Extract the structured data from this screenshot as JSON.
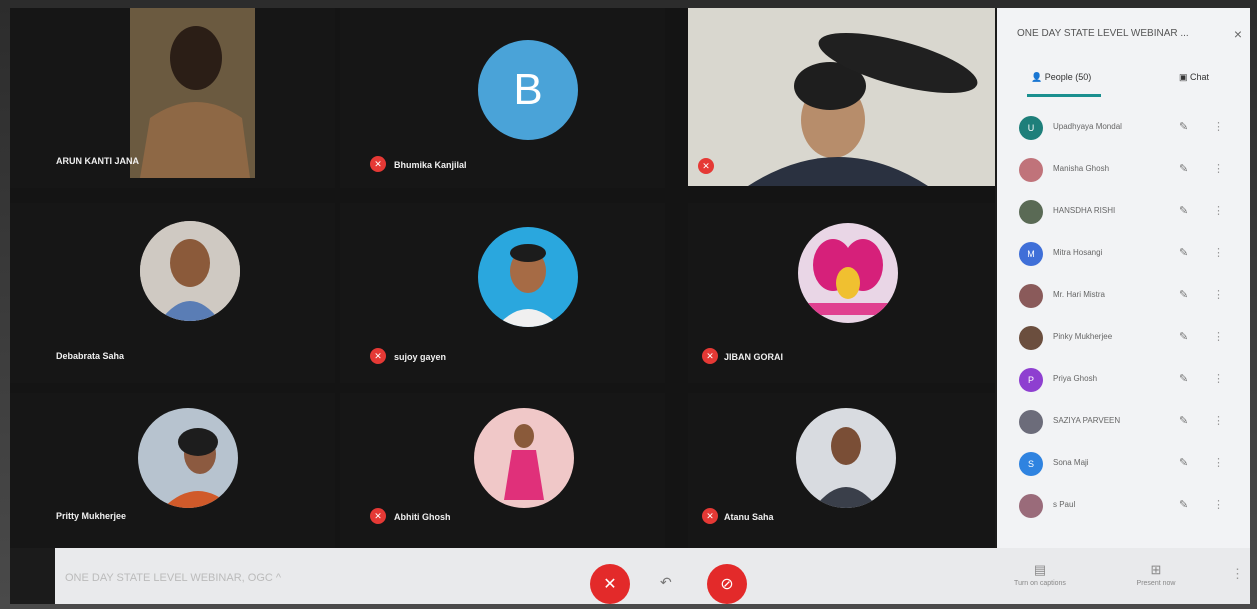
{
  "meeting_title": "ONE DAY STATE LEVEL WEBINAR, OGC",
  "tiles": {
    "t1": {
      "name": "ARUN KANTI JANA"
    },
    "t2": {
      "name": "Bhumika Kanjilal",
      "initial": "B"
    },
    "t3": {
      "name": ""
    },
    "t4": {
      "name": "Debabrata Saha"
    },
    "t5": {
      "name": "sujoy gayen"
    },
    "t6": {
      "name": "JIBAN GORAI"
    },
    "t7": {
      "name": "Pritty Mukherjee"
    },
    "t8": {
      "name": "Abhiti Ghosh"
    },
    "t9": {
      "name": "Atanu Saha"
    }
  },
  "panel": {
    "title": "ONE DAY STATE LEVEL WEBINAR ...",
    "close_icon": "×",
    "tab_people": "People (50)",
    "tab_chat": "Chat",
    "participants": [
      {
        "initial": "U",
        "name": "Upadhyaya Mondal",
        "color": "#1e7f7a"
      },
      {
        "initial": "",
        "name": "Manisha Ghosh",
        "color": "#c0737a"
      },
      {
        "initial": "",
        "name": "HANSDHA RISHI",
        "color": "#5a6a55"
      },
      {
        "initial": "M",
        "name": "Mitra Hosangi",
        "color": "#3f6fd8"
      },
      {
        "initial": "",
        "name": "Mr. Hari Mistra",
        "color": "#8a5a5a"
      },
      {
        "initial": "",
        "name": "Pinky Mukherjee",
        "color": "#6b4e3e"
      },
      {
        "initial": "P",
        "name": "Priya Ghosh",
        "color": "#8e3fd0"
      },
      {
        "initial": "",
        "name": "SAZIYA PARVEEN",
        "color": "#6c6c7a"
      },
      {
        "initial": "S",
        "name": "Sona Maji",
        "color": "#2f83e0"
      },
      {
        "initial": "",
        "name": "s Paul",
        "color": "#9a6b7a"
      }
    ]
  },
  "bar": {
    "title": "ONE DAY STATE LEVEL WEBINAR, OGC",
    "mic_icon": "✕",
    "cam_icon": "⊘",
    "captions_label": "Turn on captions",
    "present_label": "Present now"
  }
}
